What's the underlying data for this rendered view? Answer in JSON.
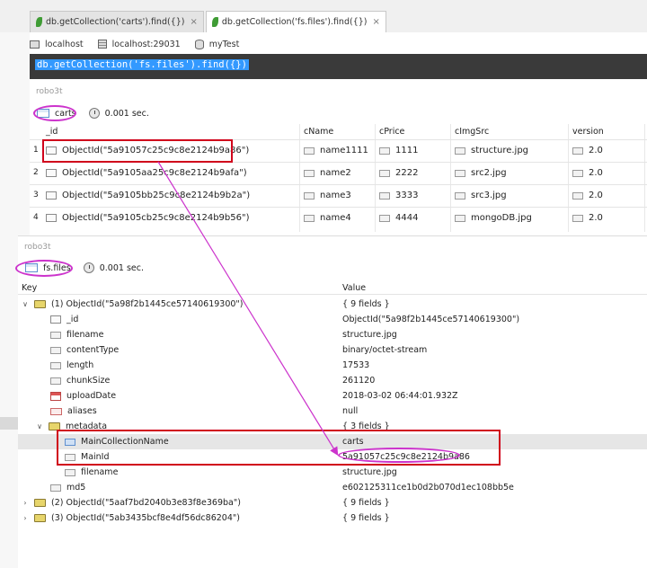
{
  "tabs": [
    {
      "label": "db.getCollection('carts').find({})",
      "close": "×"
    },
    {
      "label": "db.getCollection('fs.files').find({})",
      "close": "×"
    }
  ],
  "connection": {
    "host": "localhost",
    "server": "localhost:29031",
    "database": "myTest"
  },
  "query": "db.getCollection('fs.files').find({})",
  "panel1": {
    "label": "robo3t",
    "collection": "carts",
    "time": "0.001 sec.",
    "columns": [
      "_id",
      "cName",
      "cPrice",
      "cImgSrc",
      "version"
    ],
    "rows": [
      {
        "n": "1",
        "id": "ObjectId(\"5a91057c25c9c8e2124b9a86\")",
        "cName": "name1111",
        "cPrice": "1111",
        "cImgSrc": "structure.jpg",
        "version": "2.0"
      },
      {
        "n": "2",
        "id": "ObjectId(\"5a9105aa25c9c8e2124b9afa\")",
        "cName": "name2",
        "cPrice": "2222",
        "cImgSrc": "src2.jpg",
        "version": "2.0"
      },
      {
        "n": "3",
        "id": "ObjectId(\"5a9105bb25c9c8e2124b9b2a\")",
        "cName": "name3",
        "cPrice": "3333",
        "cImgSrc": "src3.jpg",
        "version": "2.0"
      },
      {
        "n": "4",
        "id": "ObjectId(\"5a9105cb25c9c8e2124b9b56\")",
        "cName": "name4",
        "cPrice": "4444",
        "cImgSrc": "mongoDB.jpg",
        "version": "2.0"
      }
    ]
  },
  "panel2": {
    "label": "robo3t",
    "collection": "fs.files",
    "time": "0.001 sec.",
    "key_header": "Key",
    "value_header": "Value",
    "rows": [
      {
        "key": "(1) ObjectId(\"5a98f2b1445ce57140619300\")",
        "value": "{ 9 fields }"
      },
      {
        "key": "_id",
        "value": "ObjectId(\"5a98f2b1445ce57140619300\")"
      },
      {
        "key": "filename",
        "value": "structure.jpg"
      },
      {
        "key": "contentType",
        "value": "binary/octet-stream"
      },
      {
        "key": "length",
        "value": "17533"
      },
      {
        "key": "chunkSize",
        "value": "261120"
      },
      {
        "key": "uploadDate",
        "value": "2018-03-02 06:44:01.932Z"
      },
      {
        "key": "aliases",
        "value": "null"
      },
      {
        "key": "metadata",
        "value": "{ 3 fields }"
      },
      {
        "key": "MainCollectionName",
        "value": "carts"
      },
      {
        "key": "MainId",
        "value": "5a91057c25c9c8e2124b9a86"
      },
      {
        "key": "filename",
        "value": "structure.jpg"
      },
      {
        "key": "md5",
        "value": "e602125311ce1b0d2b070d1ec108bb5e"
      },
      {
        "key": "(2) ObjectId(\"5aaf7bd2040b3e83f8e369ba\")",
        "value": "{ 9 fields }"
      },
      {
        "key": "(3) ObjectId(\"5ab3435bcf8e4df56dc86204\")",
        "value": "{ 9 fields }"
      }
    ]
  },
  "icons": {
    "tab": "leaf-icon",
    "collection": "collection-icon",
    "clock": "clock-icon",
    "object": "object-icon"
  },
  "colors": {
    "annotation_rect": "#d0021b",
    "annotation_ellipse": "#cc33cc",
    "query_highlight": "#3399ff",
    "query_bg": "#3a3a3a"
  }
}
